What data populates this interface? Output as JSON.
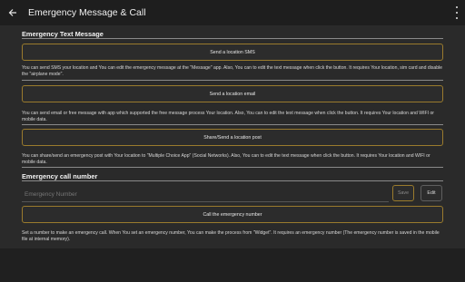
{
  "appbar": {
    "back_icon": "arrow-back-icon",
    "title": "Emergency Message & Call",
    "menu_icon": "more-vert-icon"
  },
  "text_section": {
    "title": "Emergency Text Message",
    "sms_button": "Send a location SMS",
    "sms_desc": "You can send SMS your location and You can edit the emergency message at the \"Message\" app. Also, You can to edit the text message when click the button.  It requires Your location, sim card and disable the \"airplane mode\".",
    "email_button": "Send a location email",
    "email_desc": "You can send email or free message with app which supported the free message process Your location. Also, You can to edit the text message when click the button.  It requires Your location and WIFI or mobile data.",
    "share_button": "Share/Send a location post",
    "share_desc": "You can share/send an emergency post with Your location to \"Multiple Choice App\" (Social Networks). Also, You can to edit the text message when click the button.  It requires Your location and WIFI or mobile data."
  },
  "call_section": {
    "title": "Emergency call number",
    "number_placeholder": "Emergency Number",
    "save_button": "Save",
    "edit_button": "Edit",
    "call_button": "Call the emergency number",
    "call_desc": "Set a number to make an emergency call. When You set an emergency number, You can make the process from \"Widget\". It requires an emergency number (The emergency number is saved in the mobile file at internal memory)."
  },
  "colors": {
    "background": "#2a2a2a",
    "appbar": "#1e1e1e",
    "button_border": "#9a7b2d"
  }
}
